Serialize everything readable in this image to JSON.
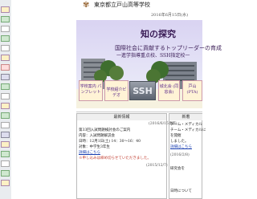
{
  "header": {
    "logo_icon": "school-crest-icon",
    "school_name": "東京都立戸山高等学校",
    "date": "2016年6月15日(水)"
  },
  "hero": {
    "title": "知の探究",
    "line1": "国際社会に貢献するトップリーダーの育成",
    "line2": "一進学指導重点校、SSH指定校一"
  },
  "quick_links": [
    {
      "label": "学校案内 パンフレット",
      "color": "#5a2a8a"
    },
    {
      "label": "学校紹介ビデオ",
      "color": "#5a2a8a"
    },
    {
      "label": "SSH",
      "color": "#e8eaf0"
    },
    {
      "label": "城北会 (同窓会)",
      "color": "#5a2a8a"
    },
    {
      "label": "戸山 (PTA)",
      "color": "#5a2a8a"
    }
  ],
  "news": {
    "heading": "最新情報",
    "updated": "(2016/6/15更新)",
    "items": [
      "第33回入試問題検討会のご案内",
      "内容：入試問題解説会",
      "日時：12月1日(土) 14：30～16：40",
      "対象：中学生3年生",
      "詳細はこちら",
      "※申し込みは締め切らせていただきました。"
    ],
    "footer_date": "(2015/12/7)"
  },
  "side": {
    "heading": "新着",
    "items": [
      "チーム・メディカル",
      "チーム・メディカルに",
      "を開催",
      "しました。",
      "詳細はこちら",
      "(2016/2/8)",
      "研究会を",
      "日時について"
    ]
  },
  "colors": {
    "accent": "#5a2a8a",
    "hero_bg": "#d8d4f0",
    "button_bg": "#fff3d6"
  }
}
